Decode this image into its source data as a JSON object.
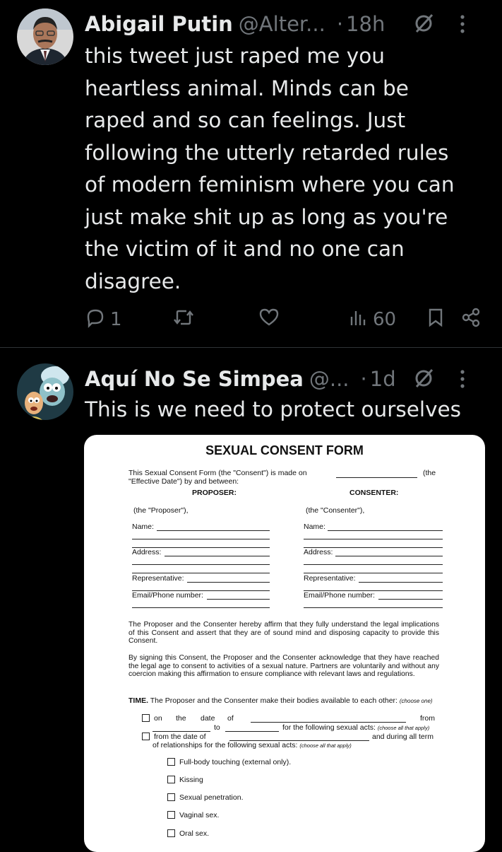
{
  "tweets": [
    {
      "author_name": "Abigail Putin",
      "handle": "@Alter...",
      "separator": "·",
      "time": "18h",
      "avatar": "man-in-suit-avatar",
      "text": "this tweet just raped me you\nheartless animal. Minds can be\nraped and so can feelings. Just\nfollowing the utterly retarded rules\nof modern feminism where you can\njust make shit up as long as you're\nthe victim of it and no one can\ndisagree.",
      "replies": "1",
      "views": "60"
    },
    {
      "author_name": "Aquí No Se Simpea",
      "handle": "@...",
      "separator": "·",
      "time": "1d",
      "avatar": "cartoon-characters-avatar",
      "text": "This is we need to protect ourselves"
    }
  ],
  "form": {
    "title": "SEXUAL CONSENT FORM",
    "intro_line1": "This Sexual Consent Form (the \"Consent\") is made on",
    "intro_the": "(the",
    "intro_line2": "\"Effective Date\") by and between:",
    "proposer_heading": "PROPOSER:",
    "consenter_heading": "CONSENTER:",
    "proposer_def": "(the \"Proposer\"),",
    "consenter_def": "(the \"Consenter\"),",
    "name_label": "Name:",
    "address_label": "Address:",
    "representative_label": "Representative:",
    "email_label": "Email/Phone number:",
    "para1": "The Proposer and the Consenter hereby affirm that they fully understand the legal implications of this Consent and assert that they are of sound mind and disposing capacity to provide this Consent.",
    "para2": "By signing this Consent, the Proposer and the Consenter acknowledge that they have reached the legal age to consent to activities of a sexual nature. Partners are voluntarily and without any coercion making this affirmation to ensure compliance with relevant laws and regulations.",
    "time_label": "TIME.",
    "time_text": "The Proposer and the Consenter make their bodies available to each other:",
    "choose_one": "(choose one)",
    "opt1_on": "on",
    "opt1_the": "the",
    "opt1_date": "date",
    "opt1_of": "of",
    "opt1_from": "from",
    "opt1_to": "to",
    "opt1_for": "for the following sexual acts:",
    "choose_all": "(choose all that apply)",
    "opt2_from": "from the date of",
    "opt2_end": "and during all term",
    "opt2_line2": "of relationships for the following sexual acts:",
    "acts": [
      "Full-body touching (external only).",
      "Kissing",
      "Sexual penetration.",
      "Vaginal sex.",
      "Oral sex."
    ]
  },
  "colors": {
    "background": "#000000",
    "text": "#e7e9ea",
    "muted": "#71767b",
    "divider": "#2f3336"
  }
}
